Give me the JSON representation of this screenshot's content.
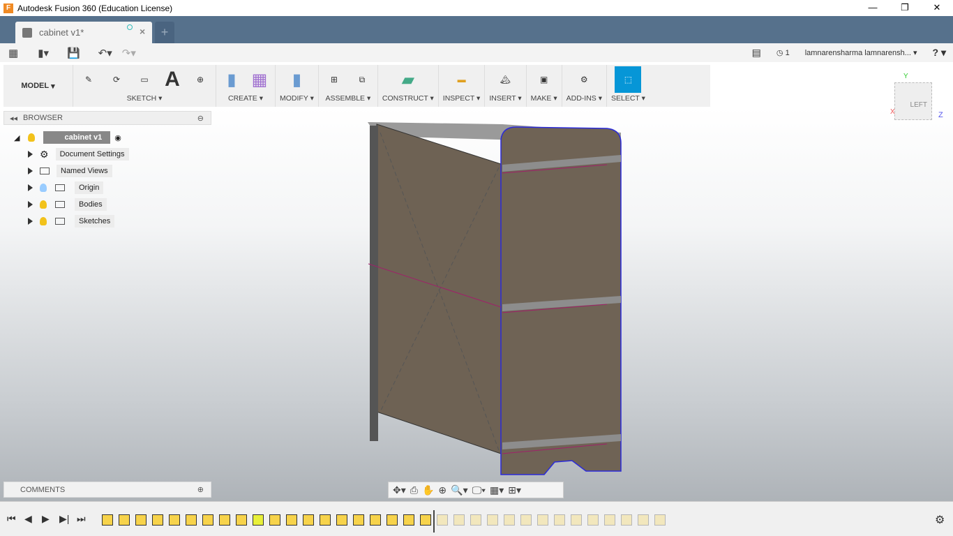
{
  "window": {
    "title": "Autodesk Fusion 360 (Education License)",
    "app_icon": "F",
    "controls": [
      "—",
      "❐",
      "✕"
    ]
  },
  "tabs": {
    "active": "cabinet v1*",
    "new": "+"
  },
  "quickbar": {
    "notifications_count": "1",
    "user": "lamnarensharma lamnarensh...",
    "help": "?"
  },
  "toolbar": {
    "workspace": "MODEL",
    "groups": [
      "SKETCH",
      "CREATE",
      "MODIFY",
      "ASSEMBLE",
      "CONSTRUCT",
      "INSPECT",
      "INSERT",
      "MAKE",
      "ADD-INS",
      "SELECT"
    ]
  },
  "browser": {
    "title": "BROWSER",
    "root": "cabinet v1",
    "items": [
      "Document Settings",
      "Named Views",
      "Origin",
      "Bodies",
      "Sketches"
    ]
  },
  "comments": {
    "title": "COMMENTS"
  },
  "viewcube": {
    "face": "LEFT",
    "axes": [
      "X",
      "Y",
      "Z"
    ]
  },
  "colors": {
    "tab_bar": "#56718c",
    "select_active": "#0696d7",
    "body": "#6e6254",
    "sketch_line": "#2b2bd9",
    "constraint": "#a0206a"
  },
  "timeline": {
    "features_active": 20,
    "features_suppressed": 14
  }
}
